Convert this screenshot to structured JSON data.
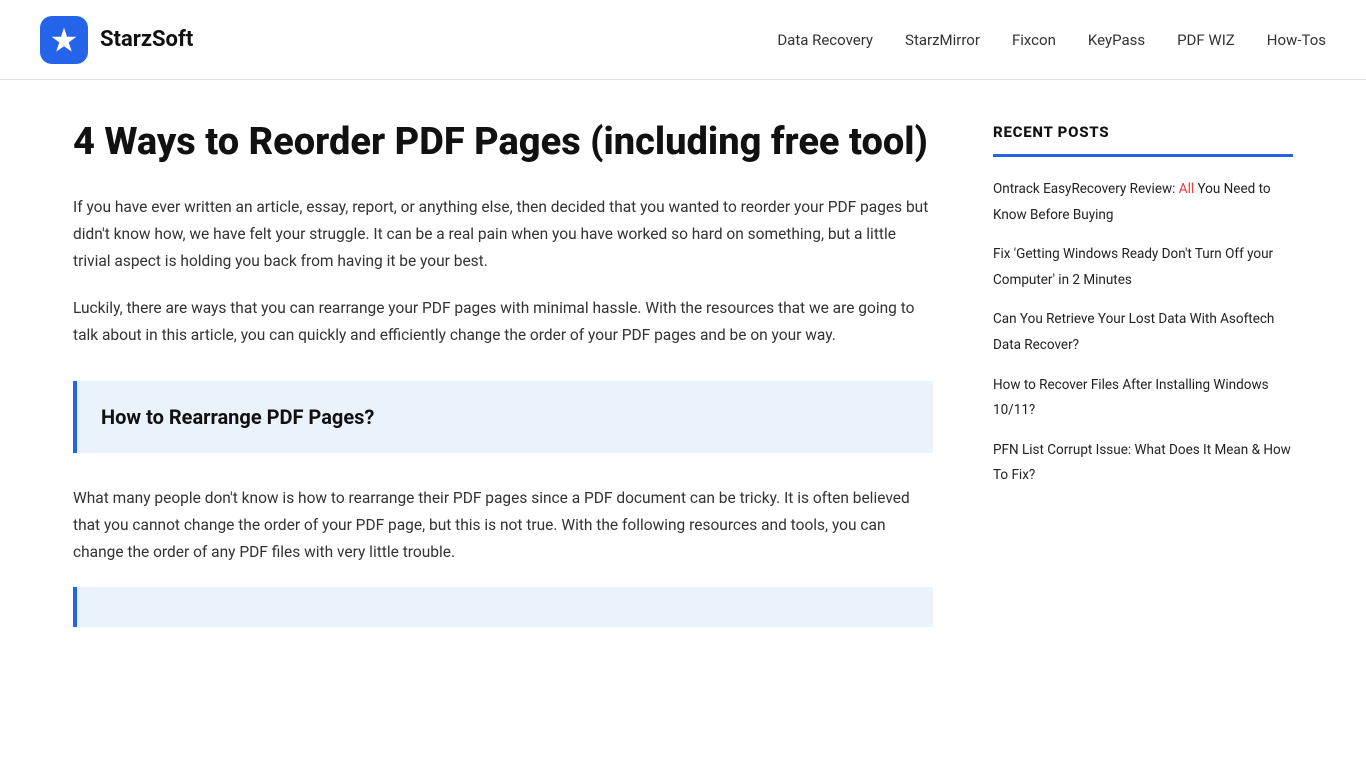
{
  "header": {
    "logo_text": "StarzSoft",
    "nav_items": [
      {
        "label": "Data Recovery",
        "href": "#"
      },
      {
        "label": "StarzMirror",
        "href": "#"
      },
      {
        "label": "Fixcon",
        "href": "#"
      },
      {
        "label": "KeyPass",
        "href": "#"
      },
      {
        "label": "PDF WIZ",
        "href": "#"
      },
      {
        "label": "How-Tos",
        "href": "#"
      }
    ]
  },
  "article": {
    "title": "4 Ways to Reorder PDF Pages (including free tool)",
    "paragraphs": [
      "If you have ever written an article, essay, report, or anything else, then decided that you wanted to reorder your PDF pages but didn't know how, we have felt your struggle. It can be a real pain when you have worked so hard on something, but a little trivial aspect is holding you back from having it be your best.",
      "Luckily, there are ways that you can rearrange your PDF pages with minimal hassle. With the resources that we are going to talk about in this article, you can quickly and efficiently change the order of your PDF pages and be on your way."
    ],
    "callout_heading": "How to Rearrange PDF Pages?",
    "callout_paragraph": "What many people don't know is how to rearrange their PDF pages since a PDF document can be tricky. It is often believed that you cannot change the order of your PDF page, but this is not true. With the following resources and tools, you can change the order of any PDF files with very little trouble."
  },
  "sidebar": {
    "recent_posts_heading": "RECENT POSTS",
    "posts": [
      {
        "text": "Ontrack EasyRecovery Review: All You Need to Know Before Buying"
      },
      {
        "text": "Fix 'Getting Windows Ready Don't Turn Off your Computer' in 2 Minutes"
      },
      {
        "text": "Can You Retrieve Your Lost Data With Asoftech Data Recover?"
      },
      {
        "text": "How to Recover Files After Installing Windows 10/11?"
      },
      {
        "text": "PFN List Corrupt Issue: What Does It Mean & How To Fix?"
      }
    ]
  }
}
